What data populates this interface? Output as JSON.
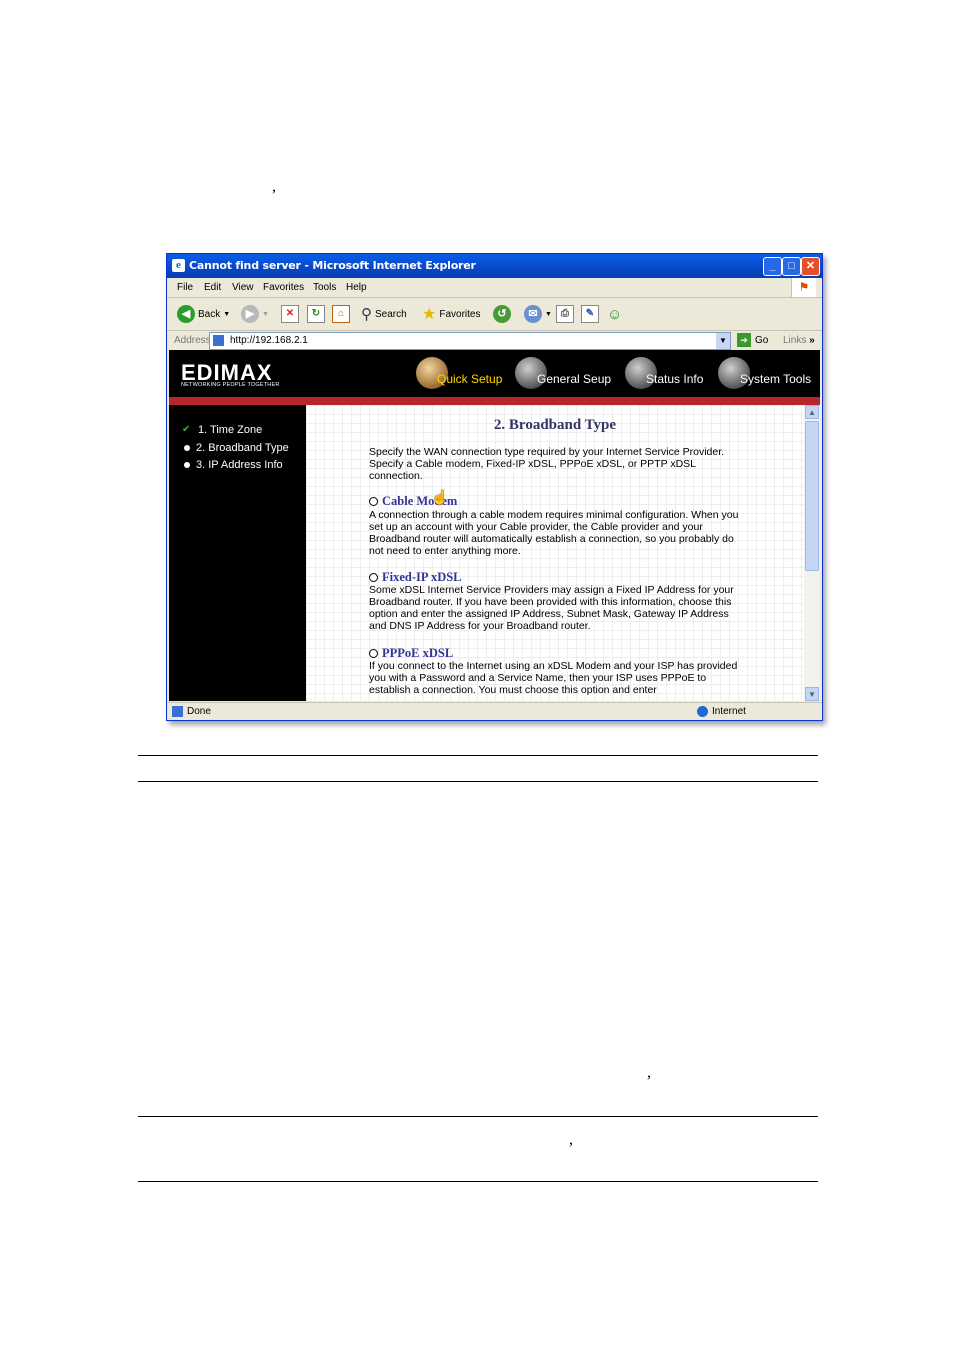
{
  "page": {
    "stray_marks": [
      ",",
      ",",
      ","
    ]
  },
  "browser": {
    "title": "Cannot find server - Microsoft Internet Explorer",
    "menu": [
      "File",
      "Edit",
      "View",
      "Favorites",
      "Tools",
      "Help"
    ],
    "toolbar": {
      "back": "Back",
      "search": "Search",
      "favorites": "Favorites"
    },
    "address_label": "Address",
    "url": "http://192.168.2.1",
    "go": "Go",
    "links": "Links",
    "status": "Done",
    "zone": "Internet"
  },
  "router": {
    "logo": "EDIMAX",
    "tagline": "NETWORKING PEOPLE TOGETHER",
    "nav": [
      "Quick Setup",
      "General Seup",
      "Status Info",
      "System Tools"
    ],
    "active_nav": "Quick Setup",
    "sidebar": [
      "1. Time Zone",
      "2. Broadband Type",
      "3. IP Address Info"
    ],
    "heading": "2. Broadband Type",
    "intro": "Specify the WAN connection type required by your Internet Service Provider. Specify a Cable modem, Fixed-IP xDSL, PPPoE xDSL, or PPTP xDSL connection.",
    "options": [
      {
        "label": "Cable Modem",
        "desc": "A connection through a cable modem requires minimal configuration. When you set up an account with your Cable provider, the Cable provider and your Broadband router will automatically establish a connection, so you probably do not need to enter anything more."
      },
      {
        "label": "Fixed-IP xDSL",
        "desc": "Some xDSL Internet Service Providers may assign a Fixed IP Address for your Broadband router. If you have been provided with this information, choose this option and enter the assigned IP Address, Subnet Mask, Gateway IP Address and DNS IP Address for your Broadband router."
      },
      {
        "label": "PPPoE xDSL",
        "desc": "If you connect to the Internet using an xDSL Modem and your ISP has provided you with a Password and a Service Name, then your ISP uses PPPoE to establish a connection. You must choose this option and enter"
      }
    ]
  },
  "colors": {
    "title_bar": "#0a53d8",
    "accent_red": "#b6262a",
    "active_nav": "#ffd500",
    "heading": "#333366"
  }
}
